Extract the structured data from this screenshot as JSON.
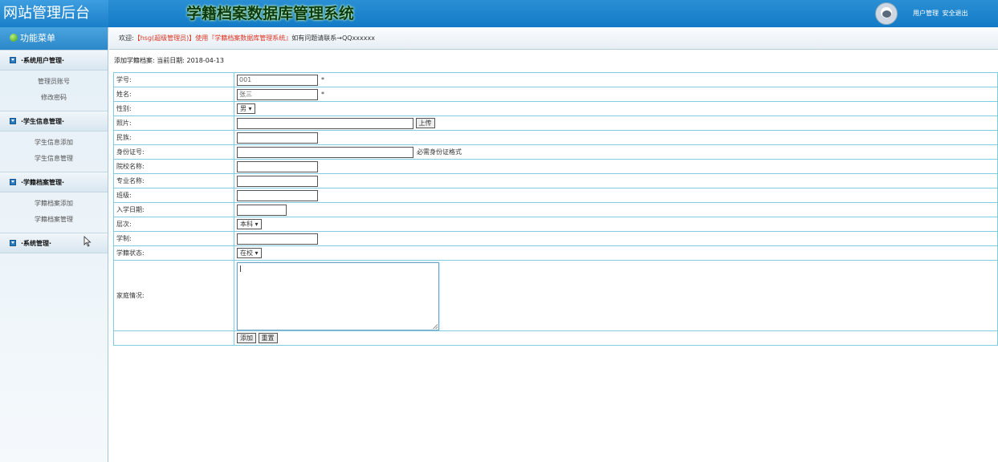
{
  "header": {
    "logo": "网站管理后台",
    "title": "学籍档案数据库管理系统",
    "links": [
      "用户管理",
      "安全退出"
    ]
  },
  "sidebar": {
    "menu_title": "功能菜单",
    "sections": [
      {
        "label": "·系统用户管理·",
        "items": [
          "管理员账号",
          "修改密码"
        ]
      },
      {
        "label": "·学生信息管理·",
        "items": [
          "学生信息添加",
          "学生信息管理"
        ]
      },
      {
        "label": "·学籍档案管理·",
        "items": [
          "学籍档案添加",
          "学籍档案管理"
        ]
      },
      {
        "label": "·系统管理·",
        "items": []
      }
    ]
  },
  "welcome": {
    "prefix": "欢迎:",
    "user": "【hsg(超级管理员)】",
    "middle": "使用",
    "system": "『学籍档案数据库管理系统』",
    "suffix": "如有问题请联系→QQxxxxxx"
  },
  "crumb": "添加学籍档案:  当前日期: 2018-04-13",
  "form": {
    "student_no": {
      "label": "学号:",
      "value": "001",
      "required": "*"
    },
    "name": {
      "label": "姓名:",
      "value": "张三",
      "required": "*"
    },
    "gender": {
      "label": "性别:",
      "value": "男 ▾"
    },
    "photo": {
      "label": "照片:",
      "value": "",
      "button": "上传"
    },
    "ethnicity": {
      "label": "民族:",
      "value": ""
    },
    "id_card": {
      "label": "身份证号:",
      "value": "",
      "hint": "必需身份证格式"
    },
    "school": {
      "label": "院校名称:",
      "value": ""
    },
    "major": {
      "label": "专业名称:",
      "value": ""
    },
    "class": {
      "label": "班级:",
      "value": ""
    },
    "enroll_date": {
      "label": "入学日期:",
      "value": ""
    },
    "level": {
      "label": "层次:",
      "value": "本科 ▾"
    },
    "duration": {
      "label": "学制:",
      "value": ""
    },
    "status": {
      "label": "学籍状态:",
      "value": "在校 ▾"
    },
    "family": {
      "label": "家庭情况:",
      "value": ""
    },
    "submit": "添加",
    "reset": "重置"
  }
}
